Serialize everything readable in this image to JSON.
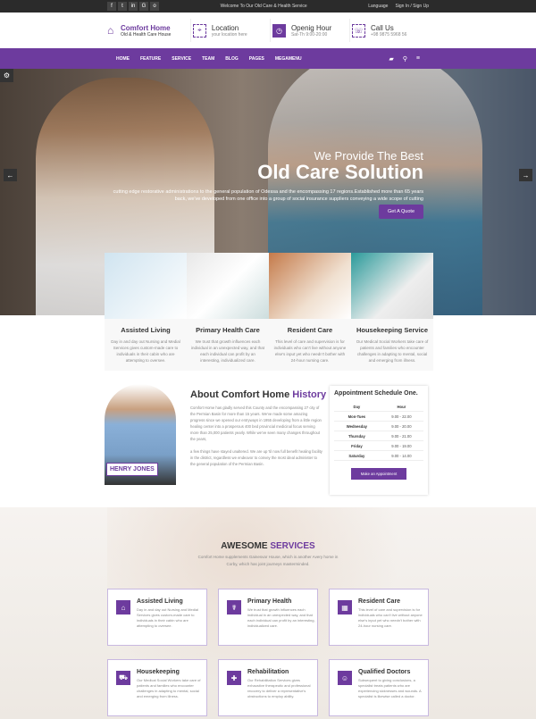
{
  "topbar": {
    "welcome": "Welcome To Our Old Care & Health Service",
    "language": "Language",
    "signin": "Sign In / Sign Up",
    "social": [
      "f",
      "t",
      "in",
      "G",
      "o"
    ]
  },
  "header": {
    "logo_title": "Comfort Home",
    "logo_sub": "Old & Health Care House",
    "location_title": "Location",
    "location_sub": "your location here",
    "hours_title": "Openig Hour",
    "hours_sub": "Sat-Th 9:00-20:00",
    "call_title": "Call Us",
    "call_sub": "+98 9875 5968 56"
  },
  "nav": {
    "items": [
      "HOME",
      "FEATURE",
      "SERVICE",
      "TEAM",
      "BLOG",
      "PAGES",
      "MEGAMENU"
    ]
  },
  "hero": {
    "sub": "We Provide The Best",
    "title": "Old Care Solution",
    "desc": "cutting edge restorative administrations to the general population of Odessa and the encompassing 17 regions.Established more than 65 years back, we've developed from one office into a group of social insurance suppliers conveying a wide scope of cutting",
    "button": "Get A Quote"
  },
  "cards": [
    {
      "title": "Assisted Living",
      "text": "Day in and day out Nursing and Medial Services gives custom-made care to individuals in their cabin who are attempting to oversee."
    },
    {
      "title": "Primary Health Care",
      "text": "We trust that growth influences each individual in an unexpected way, and that each individual can profit by an interesting, individualized care."
    },
    {
      "title": "Resident Care",
      "text": "This level of care and supervision is for individuals who can't live without anyone else's input yet who needn't bother with 24-hour nursing care."
    },
    {
      "title": "Housekeeping Service",
      "text": "Our Medical Social Workers take care of patients and families who encounter challenges in adapting to mental, social and emerging from illness."
    }
  ],
  "about": {
    "title_a": "About Comfort Home",
    "title_b": "History",
    "name": "HENRY JONES",
    "p1": "Comfort Home has gladly served this County and the encompassing 27 city of the Permian Basin for more than 15 years. We've made some amazing progress since we opened our entryways in 1955 developing from a little region healing center into a prosperous 400 bed provincial medicinal focus serving more than 25,000 patients yearly. While we've seen many changes throughout the years,",
    "p2": "a few things have stayed unaltered. We are up 'til now full benefit healing facility in the district, regardless we endeavor to convey the most ideal administer to the general population of the Permian Basin."
  },
  "schedule": {
    "title": "Appointment Schedule One.",
    "head": [
      "Day",
      "Hour"
    ],
    "rows": [
      [
        "Mon-Tues",
        "9.00 - 22.00"
      ],
      [
        "Wednesday",
        "9.00 - 20.00"
      ],
      [
        "Thursday",
        "9.00 - 21.00"
      ],
      [
        "Friday",
        "9.00 - 19.00"
      ],
      [
        "Saturday",
        "9.00 - 14.00"
      ]
    ],
    "button": "Make an Appointment"
  },
  "services": {
    "title_a": "AWESOME",
    "title_b": "SERVICES",
    "lead": "Comfort Home supplements Gainesvar House, which is another Avery home in Corby, which has joint journeys masterminded.",
    "items": [
      {
        "title": "Assisted Living",
        "icon": "home-heart-icon",
        "text": "Day in and day out Nursing and Medial Services gives custom-made care to individuals in their cabin who are attempting to oversee."
      },
      {
        "title": "Primary Health",
        "icon": "medical-icon",
        "text": "We trust that growth influences each individual in an unexpected way, and that each individual can profit by an interesting, individualized care."
      },
      {
        "title": "Resident Care",
        "icon": "building-icon",
        "text": "This level of care and supervision is for individuals who can't live without anyone else's input yet who needn't bother with 24-hour nursing care."
      },
      {
        "title": "Housekeeping",
        "icon": "truck-icon",
        "text": "Our Medical Social Workers take care of patients and families who encounter challenges in adapting to mental, social and emerging from illness."
      },
      {
        "title": "Rehabilitation",
        "icon": "cross-icon",
        "text": "Our Rehabilitation Services gives exhaustive therapeutic and professional recovery to deliver a representative's obstructions to employ ability."
      },
      {
        "title": "Qualified Doctors",
        "icon": "doctor-icon",
        "text": "Subsequent to giving conclusions, a specialist treats patients who are experiencing sicknesses and wounds. A specialist is likewise called a doctor."
      }
    ]
  },
  "colors": {
    "accent": "#6d3b9e"
  }
}
